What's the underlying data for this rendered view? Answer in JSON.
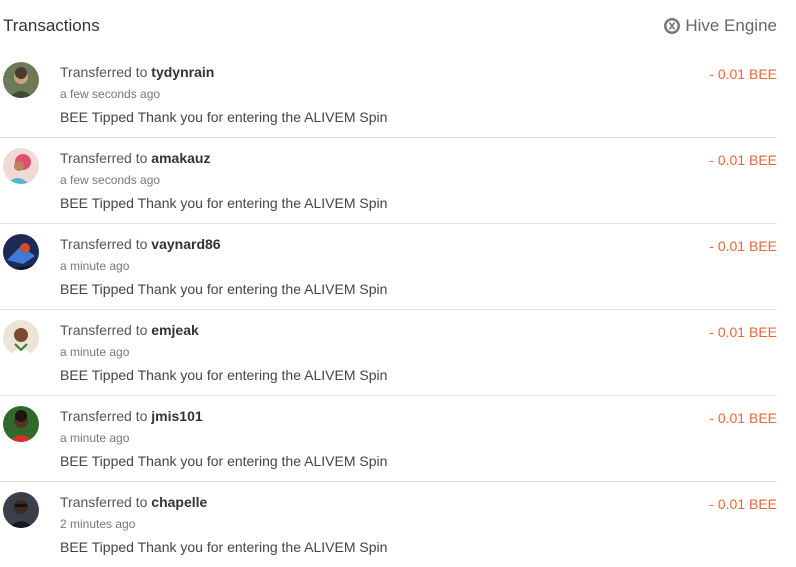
{
  "header": {
    "title": "Transactions",
    "engine_label": "Hive Engine",
    "engine_icon": "hive-engine-icon"
  },
  "transactions": [
    {
      "prefix": "Transferred to ",
      "user": "tydynrain",
      "time": "a few seconds ago",
      "memo": "BEE Tipped Thank you for entering the ALIVEM Spin",
      "amount": "- 0.01 BEE"
    },
    {
      "prefix": "Transferred to ",
      "user": "amakauz",
      "time": "a few seconds ago",
      "memo": "BEE Tipped Thank you for entering the ALIVEM Spin",
      "amount": "- 0.01 BEE"
    },
    {
      "prefix": "Transferred to ",
      "user": "vaynard86",
      "time": "a minute ago",
      "memo": "BEE Tipped Thank you for entering the ALIVEM Spin",
      "amount": "- 0.01 BEE"
    },
    {
      "prefix": "Transferred to ",
      "user": "emjeak",
      "time": "a minute ago",
      "memo": "BEE Tipped Thank you for entering the ALIVEM Spin",
      "amount": "- 0.01 BEE"
    },
    {
      "prefix": "Transferred to ",
      "user": "jmis101",
      "time": "a minute ago",
      "memo": "BEE Tipped Thank you for entering the ALIVEM Spin",
      "amount": "- 0.01 BEE"
    },
    {
      "prefix": "Transferred to ",
      "user": "chapelle",
      "time": "2 minutes ago",
      "memo": "BEE Tipped Thank you for entering the ALIVEM Spin",
      "amount": "- 0.01 BEE"
    }
  ],
  "colors": {
    "amount": "#e8683a",
    "divider": "#e3e3e3"
  }
}
